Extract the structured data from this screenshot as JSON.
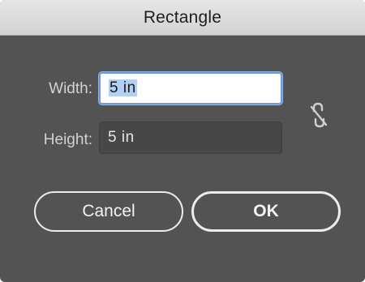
{
  "window": {
    "title": "Rectangle"
  },
  "fields": {
    "width": {
      "label": "Width:",
      "value": "5 in"
    },
    "height": {
      "label": "Height:",
      "value": "5 in"
    }
  },
  "link_icon": "unlinked-chain-icon",
  "buttons": {
    "cancel_label": "Cancel",
    "ok_label": "OK"
  },
  "colors": {
    "dialog_background": "#535353",
    "focus_ring": "#6b9ad8",
    "selection_highlight": "#b3d0f2"
  }
}
